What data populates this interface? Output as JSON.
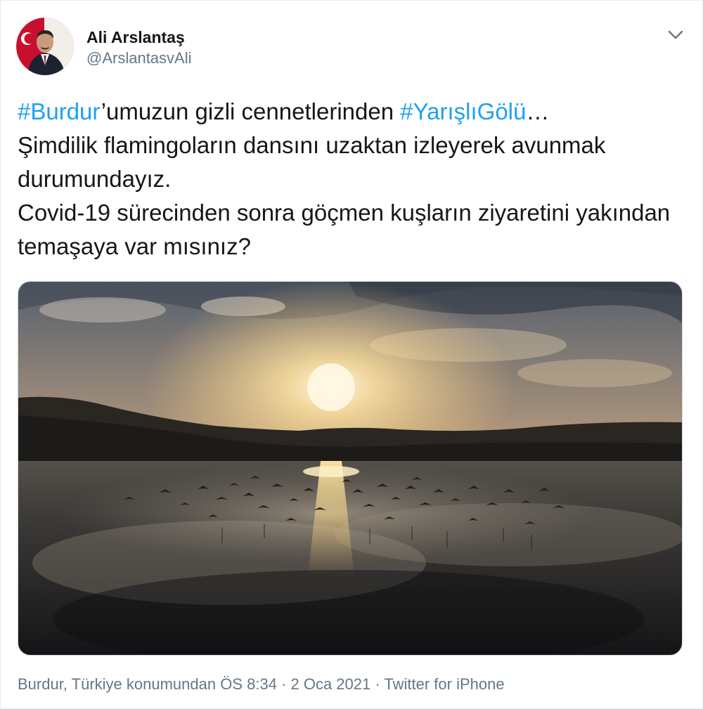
{
  "tweet": {
    "author": {
      "display_name": "Ali Arslantaş",
      "handle": "@ArslantasvAli",
      "avatar_icon": "profile-photo"
    },
    "menu_icon": "chevron-down-icon",
    "text": {
      "line1": {
        "hashtag1": "#Burdur",
        "mid": "’umuzun gizli cennetlerinden ",
        "hashtag2": "#YarışlıGölü",
        "end": "…"
      },
      "rest": "Şimdilik flamingoların dansını uzaktan izleyerek avunmak durumundayız.\nCovid-19 sürecinden sonra göçmen kuşların ziyaretini yakından temaşaya var mısınız?"
    },
    "media": {
      "kind": "video",
      "description_icon": "sunset-lake-flamingos-image"
    },
    "meta": {
      "location": "Burdur, Türkiye konumundan",
      "separator": " · ",
      "time": "ÖS 8:34",
      "date": "2 Oca 2021",
      "source": "Twitter for iPhone"
    },
    "colors": {
      "hashtag": "#1da1f2",
      "secondary_text": "#657786",
      "primary_text": "#14171a",
      "border": "#e6ecf0"
    }
  }
}
